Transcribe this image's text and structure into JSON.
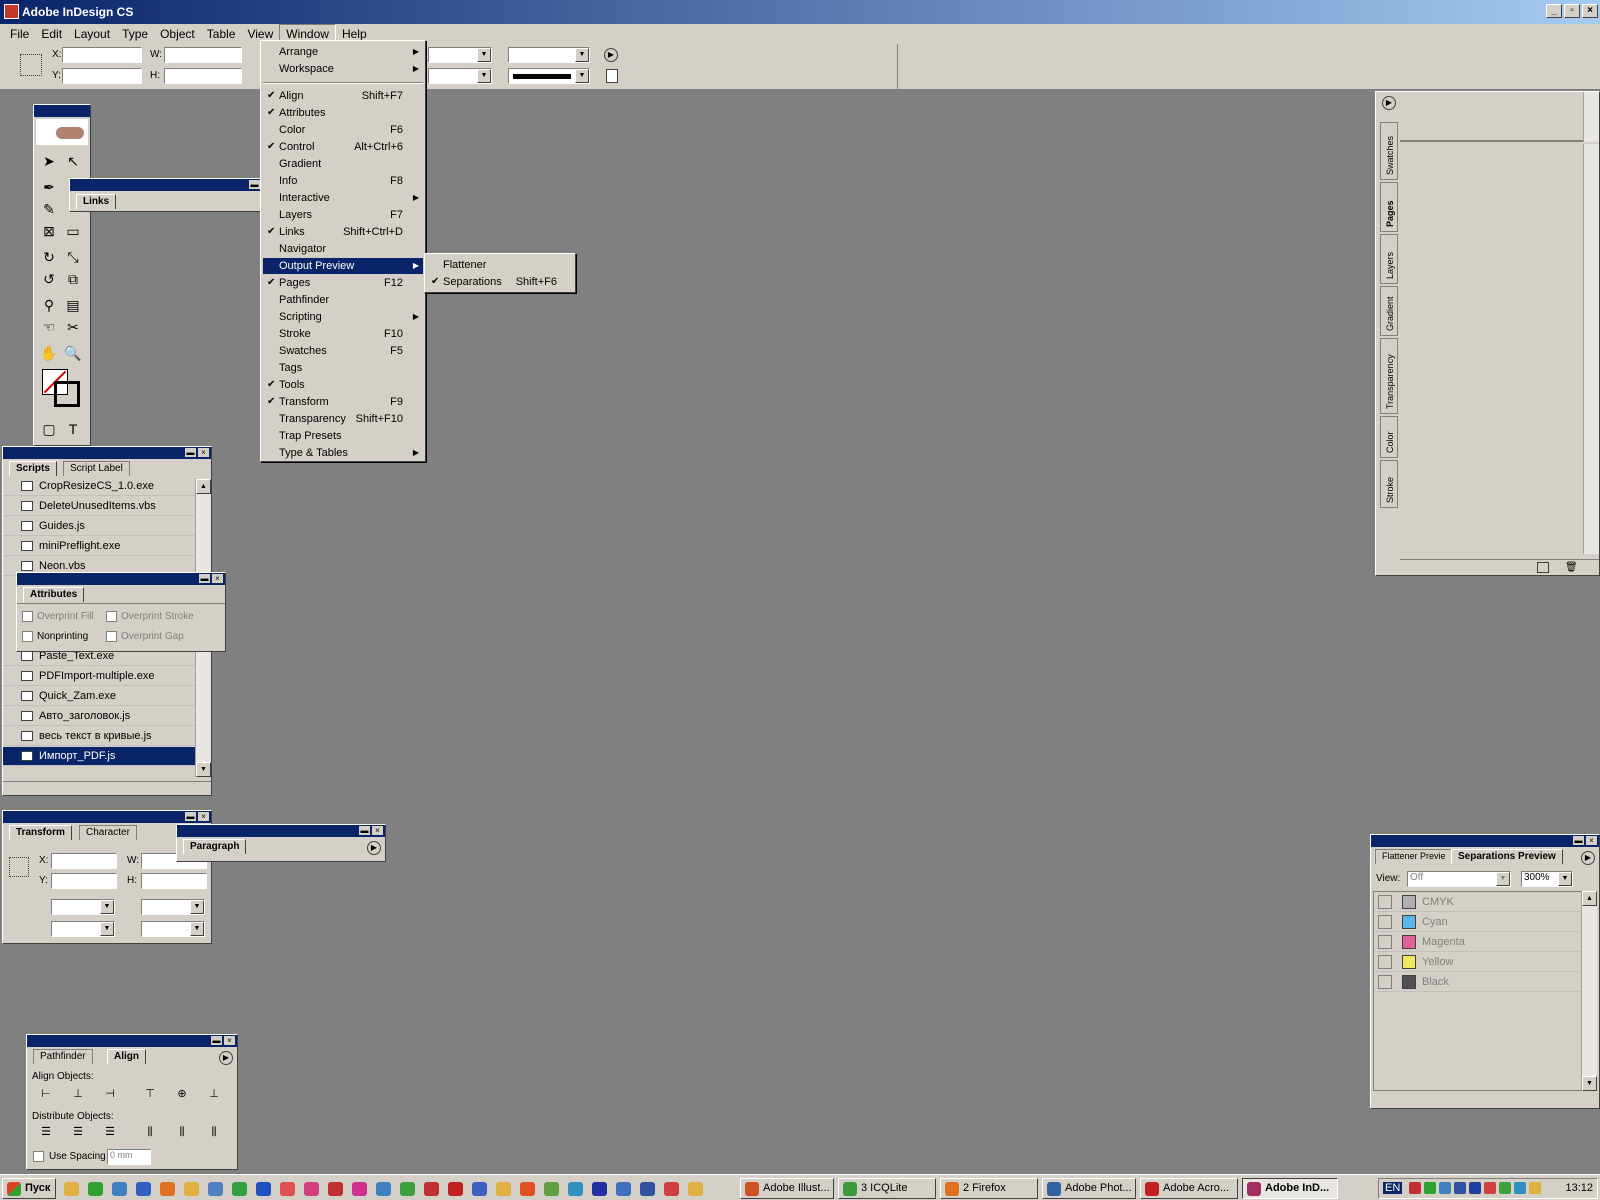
{
  "window": {
    "title": "Adobe InDesign CS"
  },
  "menubar": [
    "File",
    "Edit",
    "Layout",
    "Type",
    "Object",
    "Table",
    "View",
    "Window",
    "Help"
  ],
  "control": {
    "x": "X:",
    "y": "Y:",
    "w": "W:",
    "h": "H:"
  },
  "window_menu": [
    {
      "label": "Arrange",
      "shortcut": "",
      "checked": false,
      "submenu": true
    },
    {
      "label": "Workspace",
      "shortcut": "",
      "checked": false,
      "submenu": true
    },
    {
      "sep": true
    },
    {
      "label": "Align",
      "shortcut": "Shift+F7",
      "checked": true,
      "submenu": false
    },
    {
      "label": "Attributes",
      "shortcut": "",
      "checked": true,
      "submenu": false
    },
    {
      "label": "Color",
      "shortcut": "F6",
      "checked": false,
      "submenu": false
    },
    {
      "label": "Control",
      "shortcut": "Alt+Ctrl+6",
      "checked": true,
      "submenu": false
    },
    {
      "label": "Gradient",
      "shortcut": "",
      "checked": false,
      "submenu": false
    },
    {
      "label": "Info",
      "shortcut": "F8",
      "checked": false,
      "submenu": false
    },
    {
      "label": "Interactive",
      "shortcut": "",
      "checked": false,
      "submenu": true
    },
    {
      "label": "Layers",
      "shortcut": "F7",
      "checked": false,
      "submenu": false
    },
    {
      "label": "Links",
      "shortcut": "Shift+Ctrl+D",
      "checked": true,
      "submenu": false
    },
    {
      "label": "Navigator",
      "shortcut": "",
      "checked": false,
      "submenu": false
    },
    {
      "label": "Output Preview",
      "shortcut": "",
      "checked": false,
      "submenu": true,
      "highlighted": true
    },
    {
      "label": "Pages",
      "shortcut": "F12",
      "checked": true,
      "submenu": false
    },
    {
      "label": "Pathfinder",
      "shortcut": "",
      "checked": false,
      "submenu": false
    },
    {
      "label": "Scripting",
      "shortcut": "",
      "checked": false,
      "submenu": true
    },
    {
      "label": "Stroke",
      "shortcut": "F10",
      "checked": false,
      "submenu": false
    },
    {
      "label": "Swatches",
      "shortcut": "F5",
      "checked": false,
      "submenu": false
    },
    {
      "label": "Tags",
      "shortcut": "",
      "checked": false,
      "submenu": false
    },
    {
      "label": "Tools",
      "shortcut": "",
      "checked": true,
      "submenu": false
    },
    {
      "label": "Transform",
      "shortcut": "F9",
      "checked": true,
      "submenu": false
    },
    {
      "label": "Transparency",
      "shortcut": "Shift+F10",
      "checked": false,
      "submenu": false
    },
    {
      "label": "Trap Presets",
      "shortcut": "",
      "checked": false,
      "submenu": false
    },
    {
      "label": "Type & Tables",
      "shortcut": "",
      "checked": false,
      "submenu": true
    }
  ],
  "output_preview_submenu": [
    {
      "label": "Flattener",
      "shortcut": "",
      "checked": false
    },
    {
      "label": "Separations",
      "shortcut": "Shift+F6",
      "checked": true
    }
  ],
  "links_panel": {
    "tab": "Links"
  },
  "scripts_panel": {
    "tabs": [
      "Scripts",
      "Script Label"
    ],
    "items_top": [
      "CropResizeCS_1.0.exe",
      "DeleteUnusedItems.vbs",
      "Guides.js",
      "miniPreflight.exe",
      "Neon.vbs"
    ],
    "items_bottom": [
      "Paste_Text.exe",
      "PDFImport-multiple.exe",
      "Quick_Zam.exe",
      "Авто_заголовок.js",
      "весь текст в кривые.js",
      "Импорт_PDF.js"
    ]
  },
  "attributes_panel": {
    "tab": "Attributes",
    "overprint_fill": "Overprint Fill",
    "overprint_stroke": "Overprint Stroke",
    "nonprinting": "Nonprinting",
    "overprint_gap": "Overprint Gap"
  },
  "transform_panel": {
    "tabs": [
      "Transform",
      "Character"
    ],
    "x": "X:",
    "y": "Y:",
    "w": "W:",
    "h": "H:"
  },
  "paragraph_panel": {
    "tab": "Paragraph"
  },
  "align_panel": {
    "tabs": [
      "Pathfinder",
      "Align"
    ],
    "align_objects": "Align Objects:",
    "distribute_objects": "Distribute Objects:",
    "use_spacing": "Use Spacing",
    "spacing_value": "0 mm"
  },
  "right_dock": {
    "tabs": [
      "Swatches",
      "Pages",
      "Layers",
      "Gradient",
      "Transparency",
      "Color",
      "Stroke"
    ],
    "active": "Pages"
  },
  "separations_panel": {
    "tabs": [
      "Flattener Previe",
      "Separations Preview"
    ],
    "view_label": "View:",
    "view_value": "Off",
    "zoom_value": "300%",
    "inks": [
      {
        "name": "CMYK",
        "color": "#b0b0b0"
      },
      {
        "name": "Cyan",
        "color": "#5ab4e6"
      },
      {
        "name": "Magenta",
        "color": "#e0609a"
      },
      {
        "name": "Yellow",
        "color": "#f0e860"
      },
      {
        "name": "Black",
        "color": "#505050"
      }
    ]
  },
  "taskbar": {
    "start": "Пуск",
    "buttons": [
      {
        "label": "Adobe Illust...",
        "color": "#d05020"
      },
      {
        "label": "3 ICQLite",
        "color": "#3a9a3a"
      },
      {
        "label": "2 Firefox",
        "color": "#e07020"
      },
      {
        "label": "Adobe Phot...",
        "color": "#3060a0"
      },
      {
        "label": "Adobe Acro...",
        "color": "#c02020"
      },
      {
        "label": "Adobe InD...",
        "color": "#a03060"
      }
    ],
    "lang": "EN",
    "clock": "13:12"
  }
}
